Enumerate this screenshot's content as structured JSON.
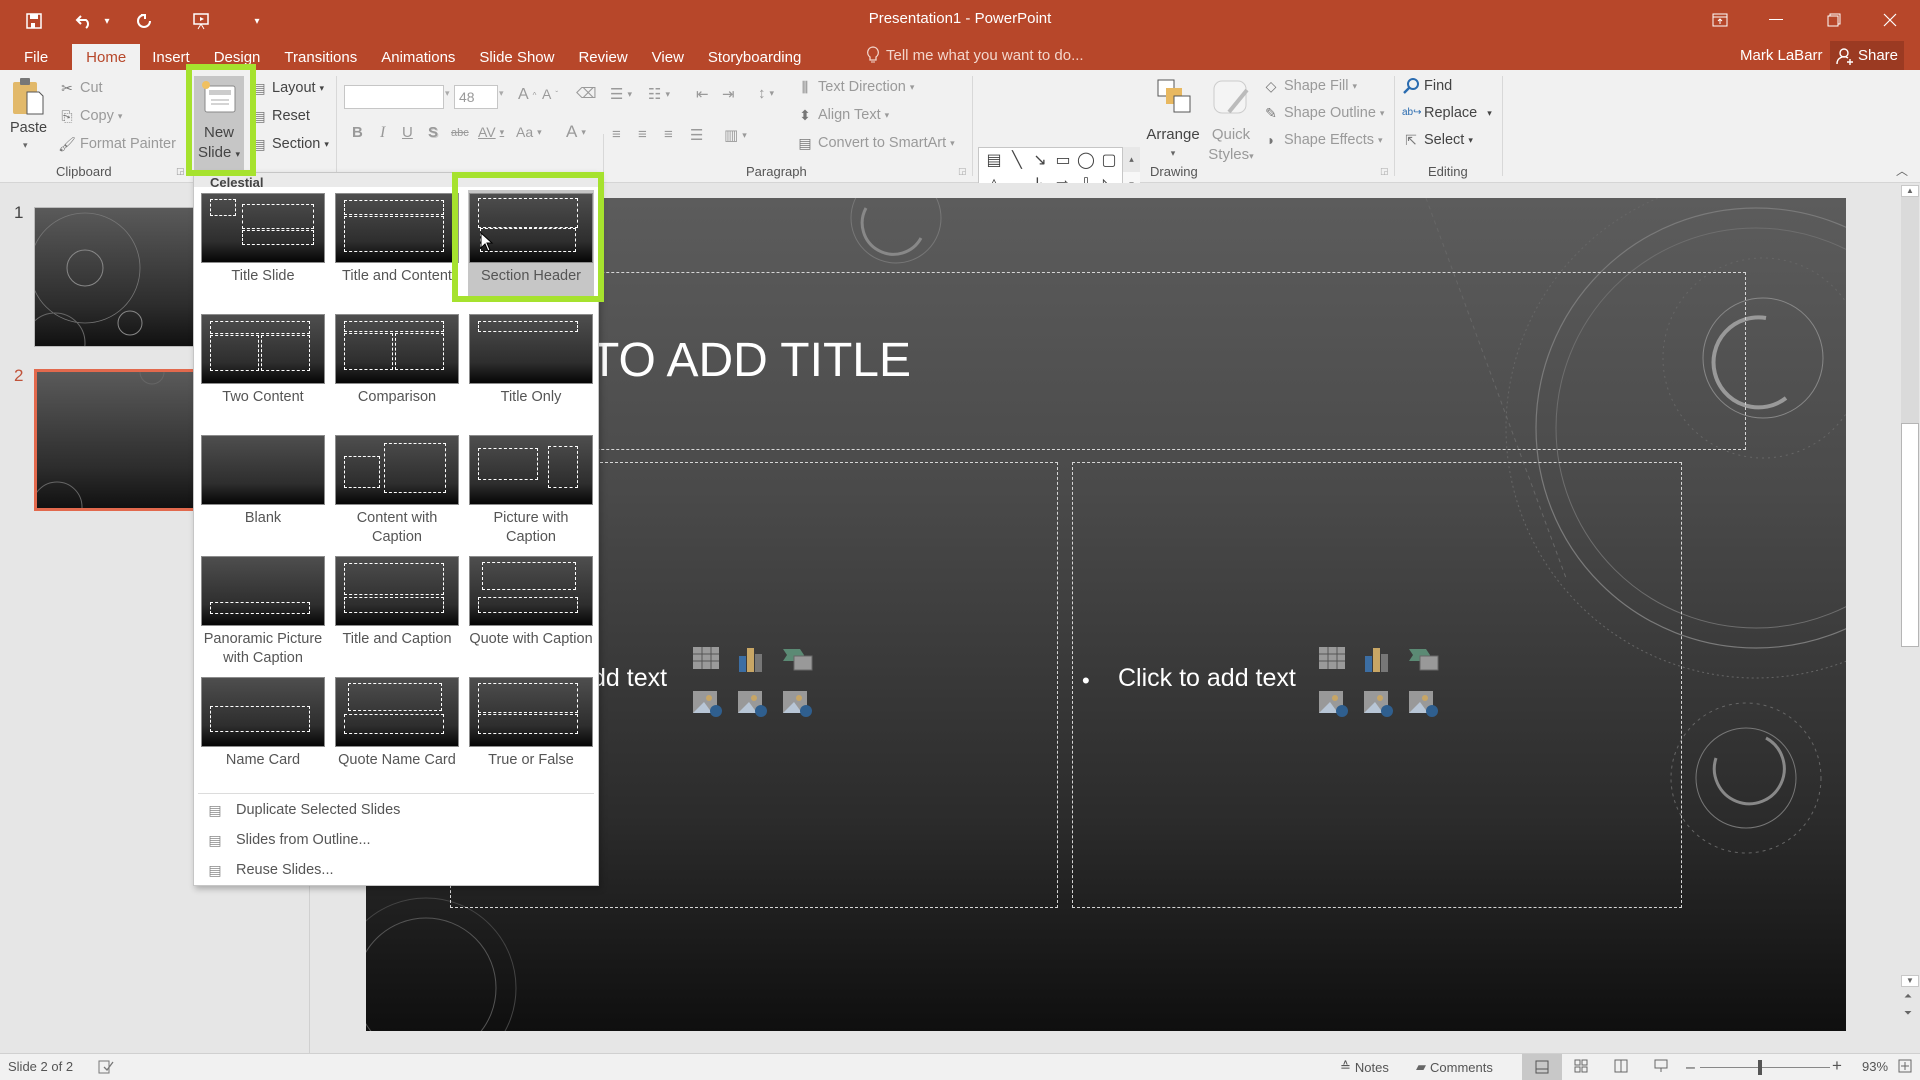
{
  "window": {
    "title": "Presentation1 - PowerPoint",
    "quick_access": [
      {
        "name": "save-icon",
        "glyph": "🖫"
      },
      {
        "name": "undo-icon",
        "glyph": "↶"
      },
      {
        "name": "undo-dropdown-icon",
        "glyph": "▾"
      },
      {
        "name": "redo-icon",
        "glyph": "↻"
      },
      {
        "name": "start-from-beginning-icon",
        "glyph": "▣"
      },
      {
        "name": "customize-qat-icon",
        "glyph": "⩡"
      }
    ],
    "controls": {
      "ribbon_display": "⊡",
      "minimize": "—",
      "restore": "❐",
      "close": "✕"
    }
  },
  "tabs": [
    "File",
    "Home",
    "Insert",
    "Design",
    "Transitions",
    "Animations",
    "Slide Show",
    "Review",
    "View",
    "Storyboarding"
  ],
  "active_tab": "Home",
  "tell_me": "Tell me what you want to do...",
  "user": "Mark LaBarr",
  "share": "Share",
  "ribbon": {
    "clipboard": {
      "label": "Clipboard",
      "paste": "Paste",
      "cut": "Cut",
      "copy": "Copy",
      "format_painter": "Format Painter"
    },
    "slides": {
      "new_slide_line1": "New",
      "new_slide_line2": "Slide",
      "layout": "Layout",
      "reset": "Reset",
      "section": "Section"
    },
    "font": {
      "font_name": "",
      "font_size": "48",
      "bold": "B",
      "italic": "I",
      "underline": "U",
      "shadow": "S",
      "strikethrough": "abc",
      "spacing": "AV",
      "case": "Aa",
      "color": "A",
      "grow": "A",
      "shrink": "A"
    },
    "paragraph": {
      "label": "Paragraph",
      "text_direction": "Text Direction",
      "align_text": "Align Text",
      "convert_smartart": "Convert to SmartArt"
    },
    "drawing": {
      "label": "Drawing",
      "arrange": "Arrange",
      "quick_styles_1": "Quick",
      "quick_styles_2": "Styles",
      "shape_fill": "Shape Fill",
      "shape_outline": "Shape Outline",
      "shape_effects": "Shape Effects",
      "shapes": [
        "▤",
        "╲",
        "↘",
        "▭",
        "◯",
        "▢",
        "△",
        "⌐",
        "↳",
        "⇨",
        "⇩",
        "◺",
        "ϟ",
        "⌒",
        "∿",
        "{",
        "}",
        "☆"
      ]
    },
    "editing": {
      "label": "Editing",
      "find": "Find",
      "replace": "Replace",
      "select": "Select"
    }
  },
  "slides_panel": {
    "slides": [
      {
        "number": "1"
      },
      {
        "number": "2",
        "selected": true
      }
    ]
  },
  "slide": {
    "title_placeholder": "TO ADD TITLE",
    "left_body": "dd text",
    "right_body": "Click to add text",
    "bullet": "•"
  },
  "new_slide_menu": {
    "theme_header": "Celestial",
    "layouts": [
      {
        "label": "Title Slide"
      },
      {
        "label": "Title and Content"
      },
      {
        "label": "Section Header",
        "hovered": true
      },
      {
        "label": "Two Content"
      },
      {
        "label": "Comparison"
      },
      {
        "label": "Title Only"
      },
      {
        "label": "Blank"
      },
      {
        "label": "Content with Caption"
      },
      {
        "label": "Picture with Caption"
      },
      {
        "label": "Panoramic Picture with Caption"
      },
      {
        "label": "Title and Caption"
      },
      {
        "label": "Quote with Caption"
      },
      {
        "label": "Name Card"
      },
      {
        "label": "Quote Name Card"
      },
      {
        "label": "True or False"
      }
    ],
    "commands": [
      "Duplicate Selected Slides",
      "Slides from Outline...",
      "Reuse Slides..."
    ]
  },
  "status": {
    "slide_count": "Slide 2 of 2",
    "notes": "Notes",
    "comments": "Comments",
    "zoom": "93%",
    "zoom_value_percent": 93
  },
  "colors": {
    "accent": "#b7472a",
    "highlight": "#a6e22e",
    "selected_slide": "#e2694d"
  }
}
